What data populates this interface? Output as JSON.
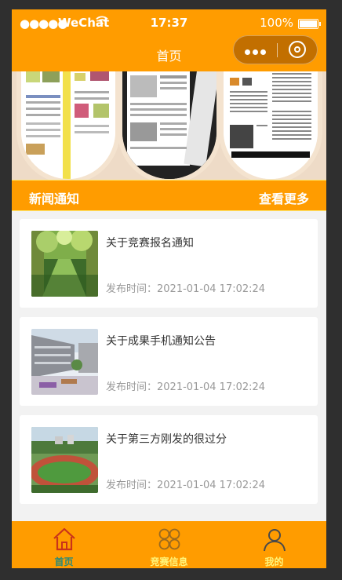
{
  "status_bar": {
    "signal": "●●●●●",
    "carrier": "WeChat",
    "time": "17:37",
    "battery": "100%"
  },
  "nav": {
    "title": "首页"
  },
  "news_section": {
    "title": "新闻通知",
    "more": "查看更多"
  },
  "news": [
    {
      "title": "关于竞赛报名通知",
      "time": "发布时间：2021-01-04 17:02:24",
      "thumb_icon": "tree-road-photo"
    },
    {
      "title": "关于成果手机通知公告",
      "time": "发布时间：2021-01-04 17:02:24",
      "thumb_icon": "campus-building-photo"
    },
    {
      "title": "关于第三方刚发的很过分",
      "time": "发布时间：2021-01-04 17:02:24",
      "thumb_icon": "sports-field-photo"
    }
  ],
  "tabbar": [
    {
      "label": "首页",
      "icon": "home-icon",
      "active": true
    },
    {
      "label": "竞赛信息",
      "icon": "grid-icon",
      "active": false
    },
    {
      "label": "我的",
      "icon": "user-icon",
      "active": false
    }
  ],
  "colors": {
    "primary": "#ff9c00",
    "active_tab": "#2a8a78",
    "tab_text": "#fff57a"
  }
}
